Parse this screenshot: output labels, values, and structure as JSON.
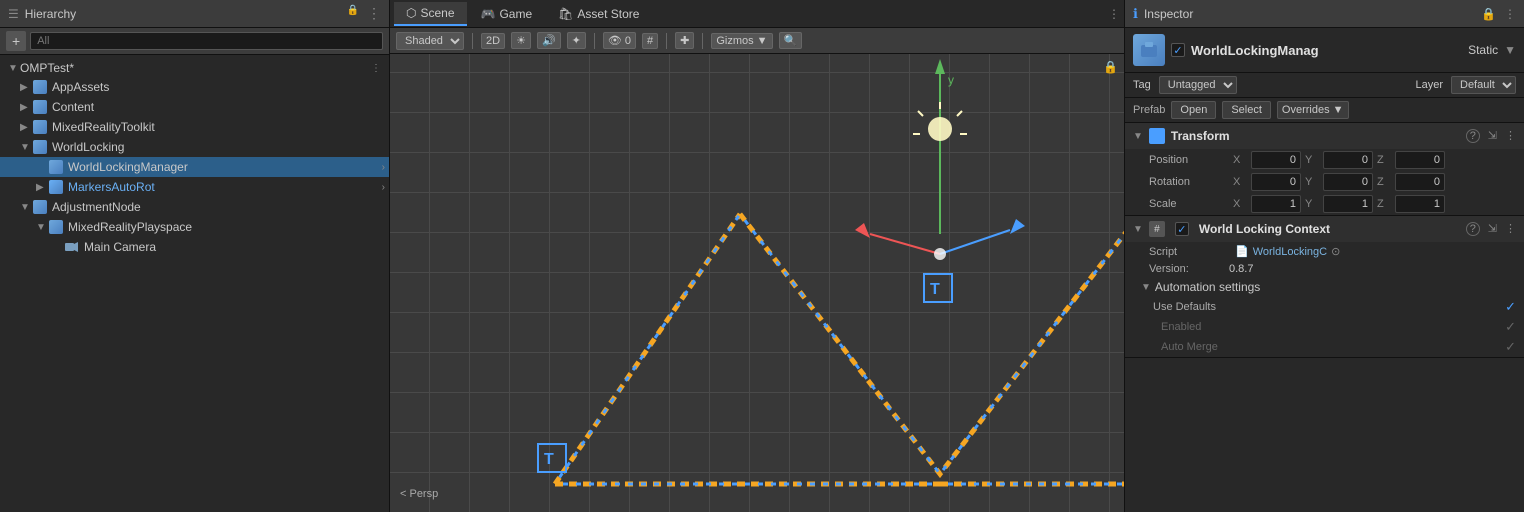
{
  "hierarchy": {
    "title": "Hierarchy",
    "search_placeholder": "All",
    "items": [
      {
        "id": "omptest",
        "label": "OMPTest*",
        "level": 0,
        "expanded": true,
        "has_children": true,
        "type": "root"
      },
      {
        "id": "appassets",
        "label": "AppAssets",
        "level": 1,
        "expanded": false,
        "has_children": true,
        "type": "cube"
      },
      {
        "id": "content",
        "label": "Content",
        "level": 1,
        "expanded": false,
        "has_children": true,
        "type": "cube"
      },
      {
        "id": "mixedreality",
        "label": "MixedRealityToolkit",
        "level": 1,
        "expanded": false,
        "has_children": true,
        "type": "cube"
      },
      {
        "id": "worldlocking",
        "label": "WorldLocking",
        "level": 1,
        "expanded": true,
        "has_children": true,
        "type": "cube"
      },
      {
        "id": "worldlockingmanager",
        "label": "WorldLockingManager",
        "level": 2,
        "expanded": false,
        "has_children": true,
        "type": "cube",
        "selected": true
      },
      {
        "id": "markersautorot",
        "label": "MarkersAutoRot",
        "level": 2,
        "expanded": false,
        "has_children": true,
        "type": "cube",
        "highlighted": true
      },
      {
        "id": "adjustmentnode",
        "label": "AdjustmentNode",
        "level": 1,
        "expanded": true,
        "has_children": true,
        "type": "cube"
      },
      {
        "id": "mixedrealityplayspace",
        "label": "MixedRealityPlayspace",
        "level": 2,
        "expanded": true,
        "has_children": true,
        "type": "cube"
      },
      {
        "id": "maincamera",
        "label": "Main Camera",
        "level": 3,
        "expanded": false,
        "has_children": false,
        "type": "camera"
      }
    ]
  },
  "viewport": {
    "tabs": [
      "Scene",
      "Game",
      "Asset Store"
    ],
    "active_tab": "Scene",
    "shading": "Shaded",
    "mode": "2D",
    "gizmos_label": "Gizmos",
    "persp_label": "< Persp"
  },
  "inspector": {
    "title": "Inspector",
    "object_name": "WorldLockingManag",
    "static_label": "Static",
    "tag_label": "Tag",
    "tag_value": "Untagged",
    "layer_label": "Layer",
    "layer_value": "Default",
    "prefab_label": "Prefab",
    "open_label": "Open",
    "select_label": "Select",
    "overrides_label": "Overrides",
    "transform": {
      "title": "Transform",
      "position": {
        "label": "Position",
        "x": "0",
        "y": "0",
        "z": "0"
      },
      "rotation": {
        "label": "Rotation",
        "x": "0",
        "y": "0",
        "z": "0"
      },
      "scale": {
        "label": "Scale",
        "x": "1",
        "y": "1",
        "z": "1"
      }
    },
    "world_locking_context": {
      "title": "World Locking Context",
      "script_label": "Script",
      "script_value": "WorldLockingC",
      "version_label": "Version:",
      "version_value": "0.8.7",
      "automation_label": "Automation settings",
      "use_defaults_label": "Use Defaults",
      "use_defaults_checked": true,
      "enabled_label": "Enabled",
      "enabled_checked": true,
      "enabled_disabled": true,
      "auto_merge_label": "Auto Merge",
      "auto_merge_checked": true,
      "auto_merge_disabled": true
    }
  }
}
